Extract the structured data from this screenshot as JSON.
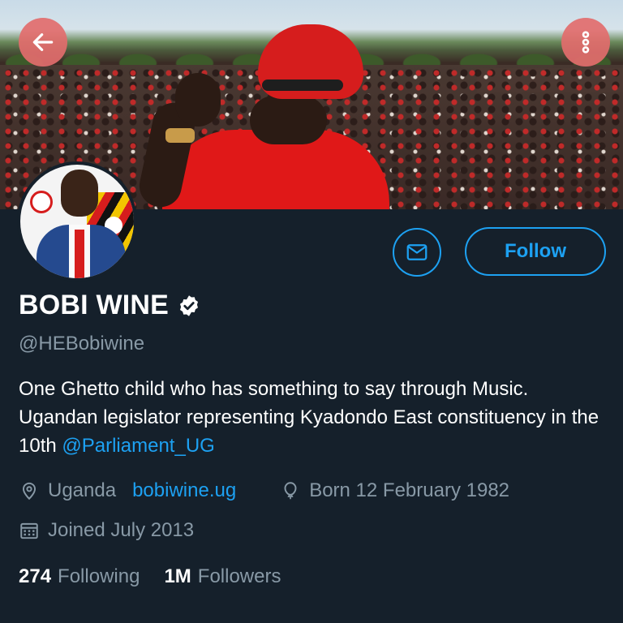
{
  "header": {
    "back_icon": "arrow-left-icon",
    "more_icon": "more-vertical-icon"
  },
  "profile": {
    "name": "BOBI WINE",
    "verified_icon": "verified-badge-icon",
    "handle": "@HEBobiwine",
    "bio_text": "One Ghetto child who has something to say through Music. Ugandan legislator representing Kyadondo East constituency in the 10th ",
    "bio_mention": "@Parliament_UG",
    "location": "Uganda",
    "website": "bobiwine.ug",
    "birthday": "Born 12 February 1982",
    "joined": "Joined July 2013",
    "following_count": "274",
    "following_label": "Following",
    "followers_count": "1M",
    "followers_label": "Followers"
  },
  "actions": {
    "message_icon": "envelope-icon",
    "follow_label": "Follow"
  },
  "colors": {
    "background": "#15202b",
    "accent": "#1da1f2",
    "secondary_text": "#8899a6",
    "round_button": "#e26c6c"
  }
}
